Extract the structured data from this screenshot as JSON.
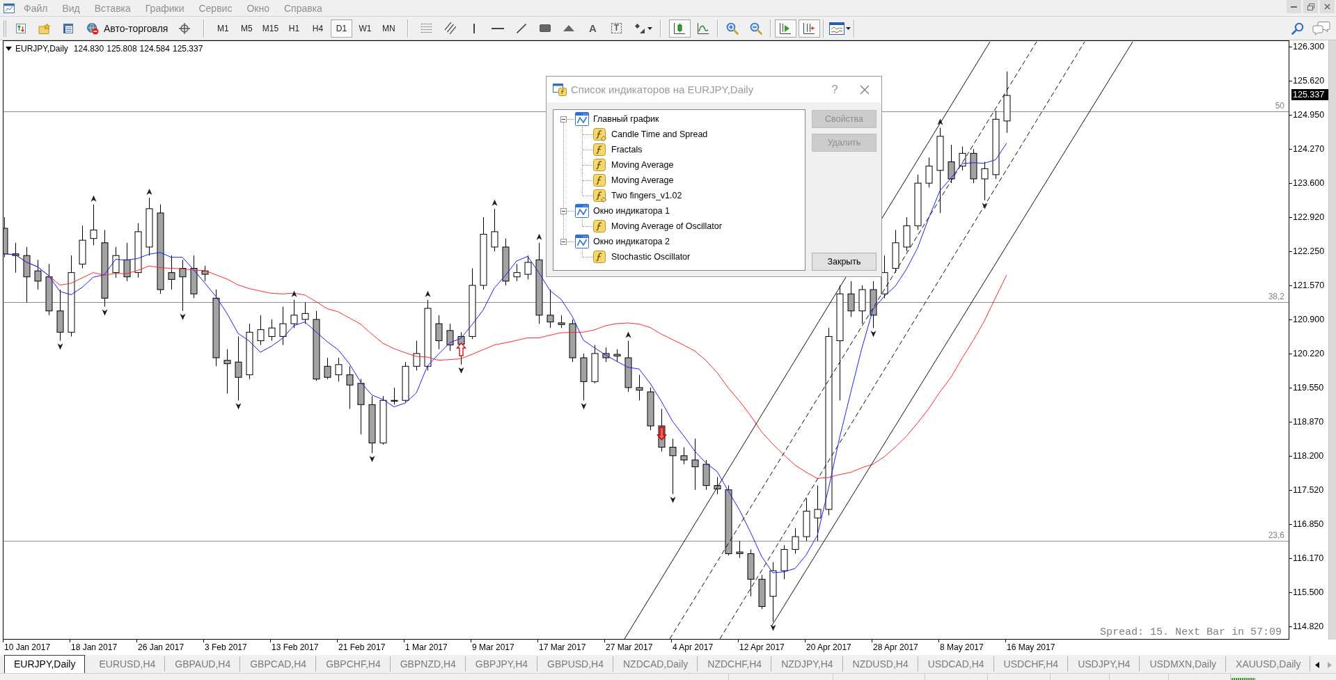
{
  "menu": [
    "Файл",
    "Вид",
    "Вставка",
    "Графики",
    "Сервис",
    "Окно",
    "Справка"
  ],
  "toolbar": {
    "autotrading": "Авто-торговля",
    "timeframes": [
      {
        "label": "M1",
        "selected": false
      },
      {
        "label": "M5",
        "selected": false
      },
      {
        "label": "M15",
        "selected": false
      },
      {
        "label": "H1",
        "selected": false
      },
      {
        "label": "H4",
        "selected": false
      },
      {
        "label": "D1",
        "selected": true
      },
      {
        "label": "W1",
        "selected": false
      },
      {
        "label": "MN",
        "selected": false
      }
    ],
    "text_tool": "A",
    "label_tool": "T",
    "chart_types": [
      {
        "kind": "candles",
        "selected": true
      },
      {
        "kind": "line",
        "selected": false
      }
    ],
    "scroll_modes": [
      {
        "kind": "autoscroll",
        "on": true
      },
      {
        "kind": "shift",
        "on": true
      }
    ]
  },
  "chart": {
    "symbol": "EURJPY,Daily",
    "ohlc": [
      "124.830",
      "125.808",
      "124.584",
      "125.337"
    ],
    "fib_levels": [
      "50",
      "38,2",
      "23,6"
    ],
    "price_labels": [
      "126.300",
      "125.620",
      "124.950",
      "124.270",
      "123.600",
      "122.920",
      "122.250",
      "121.570",
      "120.900",
      "120.220",
      "119.550",
      "118.870",
      "118.200",
      "117.520",
      "116.850",
      "116.170",
      "115.500",
      "114.820"
    ],
    "current_price": "125.337",
    "date_labels": [
      "10 Jan 2017",
      "18 Jan 2017",
      "26 Jan 2017",
      "3 Feb 2017",
      "13 Feb 2017",
      "21 Feb 2017",
      "1 Mar 2017",
      "9 Mar 2017",
      "17 Mar 2017",
      "27 Mar 2017",
      "4 Apr 2017",
      "12 Apr 2017",
      "20 Apr 2017",
      "28 Apr 2017",
      "8 May 2017",
      "16 May 2017"
    ],
    "status_text": "Spread: 15. Next Bar in 57:09"
  },
  "dialog": {
    "title": "Список индикаторов на EURJPY,Daily",
    "help": "?",
    "tree": [
      {
        "label": "Главный график",
        "kind": "window",
        "expanded": true,
        "children": [
          {
            "label": "Candle Time and Spread",
            "kind": "custom_indicator"
          },
          {
            "label": "Fractals",
            "kind": "indicator"
          },
          {
            "label": "Moving Average",
            "kind": "indicator"
          },
          {
            "label": "Moving Average",
            "kind": "indicator"
          },
          {
            "label": "Two fingers_v1.02",
            "kind": "custom_indicator"
          }
        ]
      },
      {
        "label": "Окно индикатора 1",
        "kind": "window",
        "expanded": true,
        "children": [
          {
            "label": "Moving Average of Oscillator",
            "kind": "indicator"
          }
        ]
      },
      {
        "label": "Окно индикатора 2",
        "kind": "window",
        "expanded": true,
        "children": [
          {
            "label": "Stochastic Oscillator",
            "kind": "indicator"
          }
        ]
      }
    ],
    "buttons": [
      {
        "label": "Свойства",
        "disabled": true
      },
      {
        "label": "Удалить",
        "disabled": true
      },
      {
        "label": "Закрыть",
        "disabled": false
      }
    ]
  },
  "tabs": [
    {
      "label": "EURJPY,Daily",
      "selected": true
    },
    {
      "label": "EURUSD,H4",
      "selected": false
    },
    {
      "label": "GBPAUD,H4",
      "selected": false
    },
    {
      "label": "GBPCAD,H4",
      "selected": false
    },
    {
      "label": "GBPCHF,H4",
      "selected": false
    },
    {
      "label": "GBPNZD,H4",
      "selected": false
    },
    {
      "label": "GBPJPY,H4",
      "selected": false
    },
    {
      "label": "GBPUSD,H4",
      "selected": false
    },
    {
      "label": "NZDCAD,Daily",
      "selected": false
    },
    {
      "label": "NZDCHF,H4",
      "selected": false
    },
    {
      "label": "NZDJPY,H4",
      "selected": false
    },
    {
      "label": "NZDUSD,H4",
      "selected": false
    },
    {
      "label": "USDCAD,H4",
      "selected": false
    },
    {
      "label": "USDCHF,H4",
      "selected": false
    },
    {
      "label": "USDJPY,H4",
      "selected": false
    },
    {
      "label": "USDMXN,Daily",
      "selected": false
    },
    {
      "label": "XAUUSD,Daily",
      "selected": false
    }
  ],
  "tab_scroll": [
    {
      "kind": "left",
      "disabled": false
    },
    {
      "kind": "right",
      "disabled": true
    }
  ]
}
